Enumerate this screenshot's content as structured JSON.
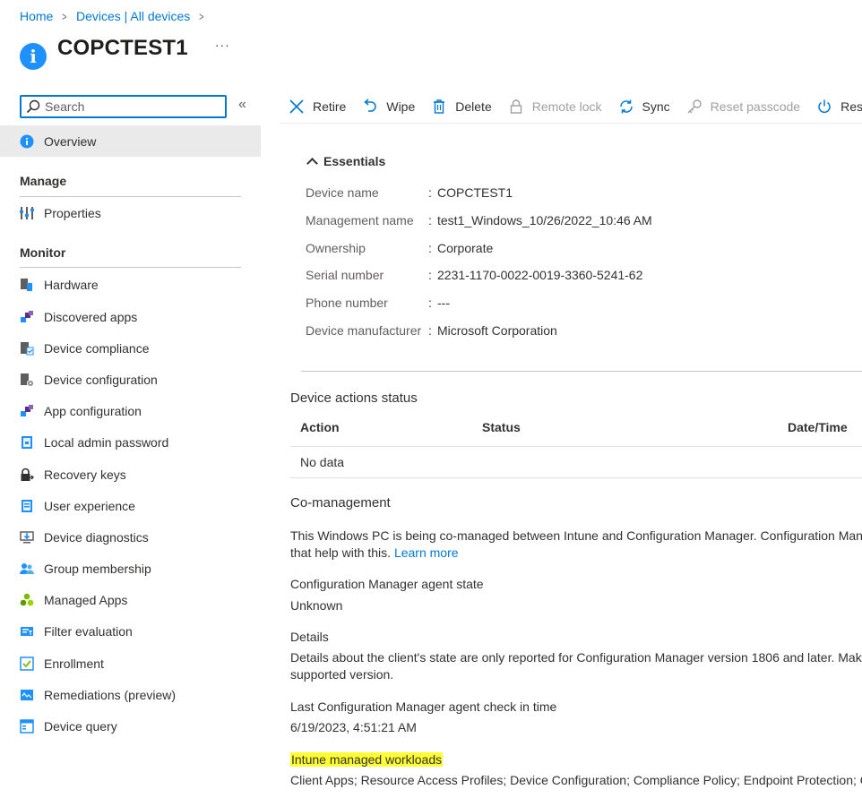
{
  "breadcrumb": {
    "home": "Home",
    "devices": "Devices | All devices",
    "sep": ">"
  },
  "header": {
    "title": "COPCTEST1",
    "more": "···"
  },
  "sidebar": {
    "search_placeholder": "Search",
    "collapse": "«",
    "overview": "Overview",
    "manage_label": "Manage",
    "manage_items": [
      "Properties"
    ],
    "monitor_label": "Monitor",
    "monitor_items": [
      "Hardware",
      "Discovered apps",
      "Device compliance",
      "Device configuration",
      "App configuration",
      "Local admin password",
      "Recovery keys",
      "User experience",
      "Device diagnostics",
      "Group membership",
      "Managed Apps",
      "Filter evaluation",
      "Enrollment",
      "Remediations (preview)",
      "Device query"
    ]
  },
  "toolbar": {
    "retire": "Retire",
    "wipe": "Wipe",
    "delete": "Delete",
    "remote_lock": "Remote lock",
    "sync": "Sync",
    "reset_passcode": "Reset passcode",
    "restart": "Restart"
  },
  "essentials": {
    "header": "Essentials",
    "rows": [
      {
        "label": "Device name",
        "value": "COPCTEST1"
      },
      {
        "label": "Management name",
        "value": "test1_Windows_10/26/2022_10:46 AM"
      },
      {
        "label": "Ownership",
        "value": "Corporate"
      },
      {
        "label": "Serial number",
        "value": "2231-1170-0022-0019-3360-5241-62"
      },
      {
        "label": "Phone number",
        "value": "---"
      },
      {
        "label": "Device manufacturer",
        "value": "Microsoft Corporation"
      }
    ]
  },
  "device_actions": {
    "title": "Device actions status",
    "col_action": "Action",
    "col_status": "Status",
    "col_datetime": "Date/Time",
    "empty": "No data"
  },
  "comanagement": {
    "title": "Co-management",
    "desc_line1": "This Windows PC is being co-managed between Intune and Configuration Manager. Configuration Manager",
    "desc_line2": "that help with this.",
    "learn_more": "Learn more",
    "agent_state_label": "Configuration Manager agent state",
    "agent_state_value": "Unknown",
    "details_label": "Details",
    "details_line1": "Details about the client's state are only reported for Configuration Manager version 1806 and later. Make sure",
    "details_line2": "supported version.",
    "checkin_label": "Last Configuration Manager agent check in time",
    "checkin_value": "6/19/2023, 4:51:21 AM",
    "workloads_label": "Intune managed workloads",
    "workloads_value": "Client Apps; Resource Access Profiles; Device Configuration; Compliance Policy; Endpoint Protection; Office"
  },
  "colors": {
    "accent": "#0078d4",
    "highlight": "#ffff33"
  }
}
